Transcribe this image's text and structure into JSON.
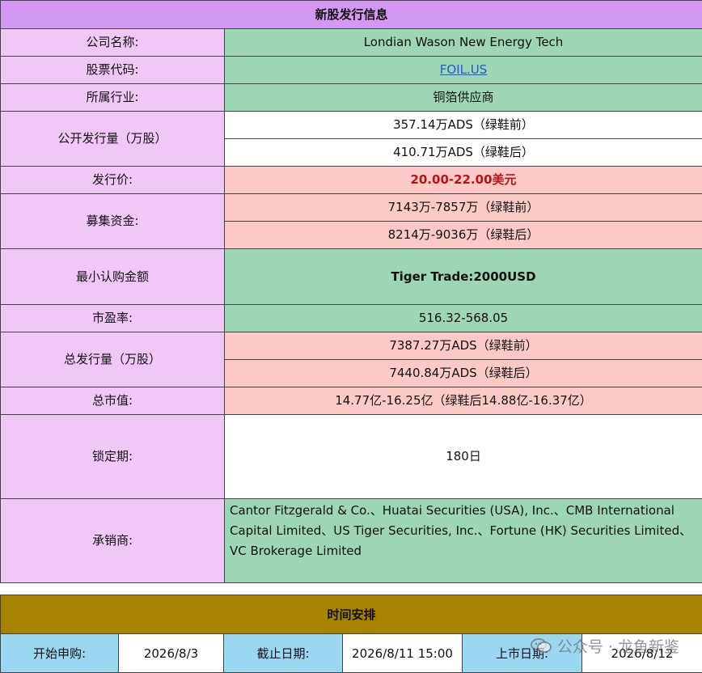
{
  "header": {
    "title": "新股发行信息"
  },
  "rows": {
    "company": {
      "label": "公司名称:",
      "value": "Londian Wason New Energy Tech"
    },
    "ticker": {
      "label": "股票代码:",
      "value": "FOIL.US"
    },
    "industry": {
      "label": "所属行业:",
      "value": "铜箔供应商"
    },
    "public_offering": {
      "label": "公开发行量（万股）",
      "values": [
        "357.14万ADS（绿鞋前）",
        "410.71万ADS（绿鞋后）"
      ]
    },
    "price": {
      "label": "发行价:",
      "value": "20.00-22.00美元"
    },
    "raise": {
      "label": "募集资金:",
      "values": [
        "7143万-7857万（绿鞋前）",
        "8214万-9036万（绿鞋后）"
      ]
    },
    "min_sub": {
      "label": "最小认购金额",
      "value": "Tiger Trade:2000USD"
    },
    "pe": {
      "label": "市盈率:",
      "value": "516.32-568.05"
    },
    "total_offering": {
      "label": "总发行量（万股）",
      "values": [
        "7387.27万ADS（绿鞋前）",
        "7440.84万ADS（绿鞋后）"
      ]
    },
    "market_cap": {
      "label": "总市值:",
      "value": "14.77亿-16.25亿（绿鞋后14.88亿-16.37亿）"
    },
    "lockup": {
      "label": "锁定期:",
      "value": "180日"
    },
    "underwriters": {
      "label": "承销商:",
      "value": "Cantor Fitzgerald & Co.、Huatai Securities (USA), Inc.、CMB International Capital Limited、US Tiger Securities, Inc.、Fortune (HK) Securities Limited、VC Brokerage Limited"
    }
  },
  "schedule": {
    "title": "时间安排",
    "start_label": "开始申购:",
    "start_value": "2026/8/3",
    "end_label": "截止日期:",
    "end_value": "2026/8/11 15:00",
    "list_label": "上市日期:",
    "list_value": "2026/8/12"
  },
  "watermark": {
    "text": "公众号 · 龙鱼新鉴",
    "icon": "wechat-icon"
  },
  "colors": {
    "header": "#d298f2",
    "label": "#f0c8f6",
    "green": "#9cd6b5",
    "pink": "#fdc9c6",
    "gold": "#a78300",
    "sky": "#9ad8f2",
    "price_text": "#b21818"
  }
}
